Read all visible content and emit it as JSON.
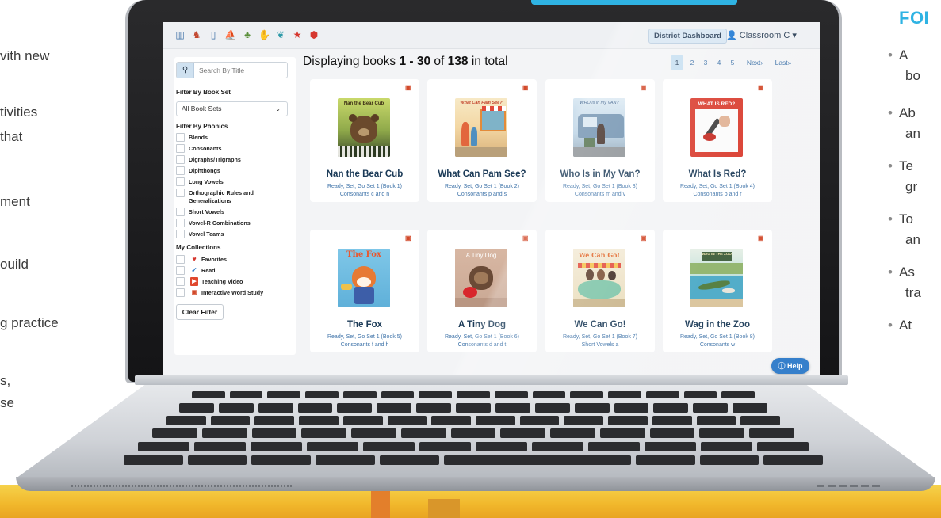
{
  "left_text": [
    "vith new",
    "tivities",
    "that",
    "ment",
    "ouild",
    "g practice",
    "s,",
    "se"
  ],
  "right_panel": {
    "heading": "FOI",
    "bullets": [
      {
        "line1": "A",
        "line2": "bo"
      },
      {
        "line1": "Ab",
        "line2": "an"
      },
      {
        "line1": "Te",
        "line2": "gr"
      },
      {
        "line1": "To",
        "line2": "an"
      },
      {
        "line1": "As",
        "line2": "tra"
      },
      {
        "line1": "At",
        "line2": ""
      }
    ]
  },
  "topbar": {
    "icons": [
      "books-icon",
      "readers-icon",
      "document-icon",
      "boat-icon",
      "family-icon",
      "hands-icon",
      "bookmark-icon",
      "star-icon",
      "badge-icon"
    ],
    "district_button": "District Dashboard",
    "classroom": "Classroom C"
  },
  "sidebar": {
    "search_placeholder": "Search By Title",
    "book_set_heading": "Filter By Book Set",
    "book_set_selected": "All Book Sets",
    "phonics_heading": "Filter By Phonics",
    "phonics": [
      "Blends",
      "Consonants",
      "Digraphs/Trigraphs",
      "Diphthongs",
      "Long Vowels",
      "Orthographic Rules and",
      "Generalizations",
      "Short Vowels",
      "Vowel-R Combinations",
      "Vowel Teams"
    ],
    "collections_heading": "My Collections",
    "collections": [
      {
        "label": "Favorites",
        "icon": "heart-icon"
      },
      {
        "label": "Read",
        "icon": "checkmark-icon"
      },
      {
        "label": "Teaching Video",
        "icon": "video-icon"
      },
      {
        "label": "Interactive Word Study",
        "icon": "word-study-icon"
      }
    ],
    "clear_filter": "Clear Filter"
  },
  "display": {
    "prefix": "Displaying books ",
    "range": "1 - 30",
    "middle": " of ",
    "total": "138",
    "suffix": " in total"
  },
  "pager": [
    "1",
    "2",
    "3",
    "4",
    "5",
    "Next›",
    "Last»"
  ],
  "books": [
    {
      "title": "Nan the Bear Cub",
      "set": "Ready, Set, Go Set 1 (Book 1)",
      "focus": "Consonants c and n",
      "cover_text": "Nan the Bear Cub"
    },
    {
      "title": "What Can Pam See?",
      "set": "Ready, Set, Go Set 1 (Book 2)",
      "focus": "Consonants p and s",
      "cover_text": "What Can Pam See?"
    },
    {
      "title": "Who Is in My Van?",
      "set": "Ready, Set, Go Set 1 (Book 3)",
      "focus": "Consonants m and v",
      "cover_text": "WHO is in my VAN?"
    },
    {
      "title": "What Is Red?",
      "set": "Ready, Set, Go Set 1 (Book 4)",
      "focus": "Consonants b and r",
      "cover_text": "WHAT IS RED?"
    },
    {
      "title": "The Fox",
      "set": "Ready, Set, Go Set 1 (Book 5)",
      "focus": "Consonants f and h",
      "cover_text": "The Fox"
    },
    {
      "title": "A Tiny Dog",
      "set": "Ready, Set, Go Set 1 (Book 6)",
      "focus": "Consonants d and t",
      "cover_text": "A Tiny Dog"
    },
    {
      "title": "We Can Go!",
      "set": "Ready, Set, Go Set 1 (Book 7)",
      "focus": "Short Vowels a",
      "cover_text": "We Can Go!"
    },
    {
      "title": "Wag in the Zoo",
      "set": "Ready, Set, Go Set 1 (Book 8)",
      "focus": "Consonants w",
      "cover_text": "WAG IN THE ZOO"
    }
  ],
  "help": "Help",
  "colors": {
    "accent_blue": "#2fb3e3",
    "gold": "#f1b72b",
    "title_blue": "#1b3a57",
    "link_blue": "#3d72a8",
    "help_blue": "#2a78c8"
  }
}
